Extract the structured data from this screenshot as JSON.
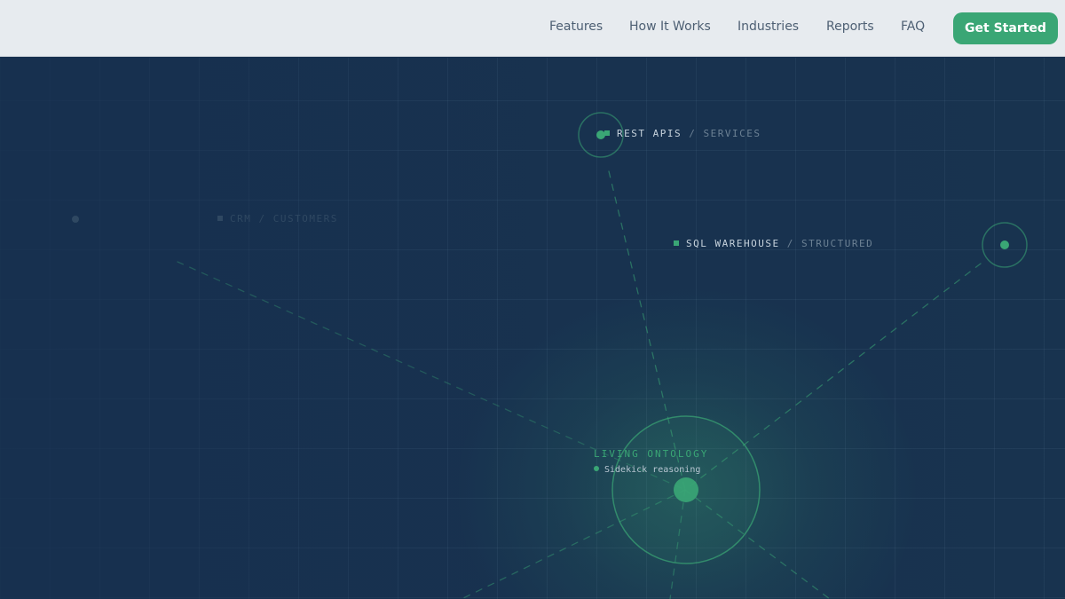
{
  "nav": {
    "links": [
      "Features",
      "How It Works",
      "Industries",
      "Reports",
      "FAQ"
    ],
    "cta_label": "Get Started"
  },
  "nodes": {
    "rest": {
      "name": "REST APIS",
      "sub": "/ SERVICES"
    },
    "sql": {
      "name": "SQL WAREHOUSE",
      "sub": "/ STRUCTURED"
    },
    "crm": {
      "name": "CRM",
      "sub": "/ CUSTOMERS"
    }
  },
  "center": {
    "title": "LIVING ONTOLOGY",
    "subtitle": "Sidekick reasoning"
  },
  "colors": {
    "accent": "#3aa675",
    "background": "#17304f",
    "nav_bg": "#e7ebef"
  }
}
